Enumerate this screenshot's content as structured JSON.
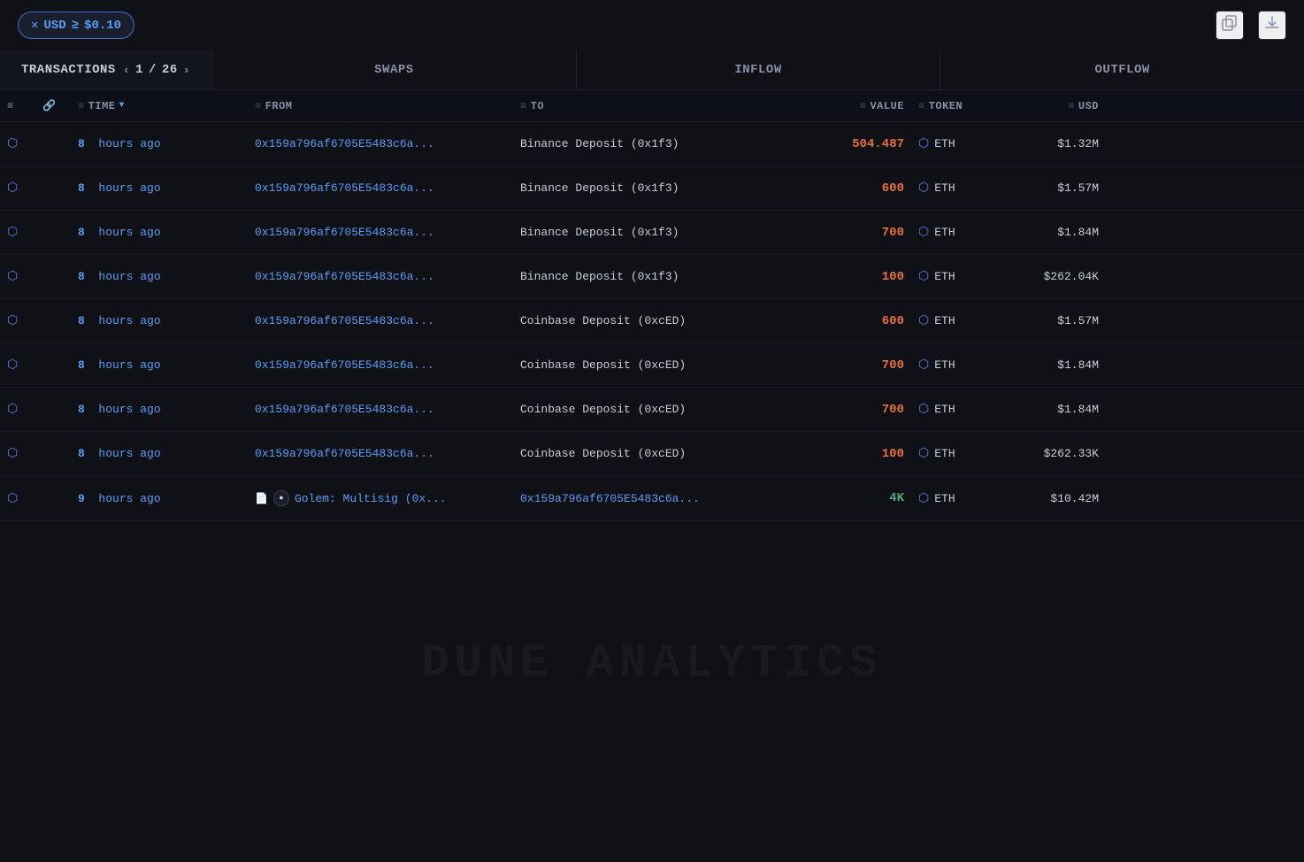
{
  "topbar": {
    "filter_label": "USD",
    "filter_geq": "≥",
    "filter_value": "$0.10",
    "copy_icon": "⧉",
    "download_icon": "↓"
  },
  "nav": {
    "transactions_label": "TRANSACTIONS",
    "page_current": "1",
    "page_separator": "/",
    "page_total": "26",
    "swaps_label": "SWAPS",
    "inflow_label": "INFLOW",
    "outflow_label": "OUTFLOW"
  },
  "columns": {
    "time_label": "TIME",
    "from_label": "FROM",
    "to_label": "TO",
    "value_label": "VALUE",
    "token_label": "TOKEN",
    "usd_label": "USD"
  },
  "rows": [
    {
      "hours": "8",
      "unit": "hours ago",
      "from": "0x159a796af6705E5483c6a...",
      "to": "Binance Deposit (0x1f3)",
      "value": "504.487",
      "value_color": "orange",
      "token": "ETH",
      "usd": "$1.32M",
      "has_doc": false,
      "has_golem": false
    },
    {
      "hours": "8",
      "unit": "hours ago",
      "from": "0x159a796af6705E5483c6a...",
      "to": "Binance Deposit (0x1f3)",
      "value": "600",
      "value_color": "orange",
      "token": "ETH",
      "usd": "$1.57M",
      "has_doc": false,
      "has_golem": false
    },
    {
      "hours": "8",
      "unit": "hours ago",
      "from": "0x159a796af6705E5483c6a...",
      "to": "Binance Deposit (0x1f3)",
      "value": "700",
      "value_color": "orange",
      "token": "ETH",
      "usd": "$1.84M",
      "has_doc": false,
      "has_golem": false
    },
    {
      "hours": "8",
      "unit": "hours ago",
      "from": "0x159a796af6705E5483c6a...",
      "to": "Binance Deposit (0x1f3)",
      "value": "100",
      "value_color": "orange",
      "token": "ETH",
      "usd": "$262.04K",
      "has_doc": false,
      "has_golem": false
    },
    {
      "hours": "8",
      "unit": "hours ago",
      "from": "0x159a796af6705E5483c6a...",
      "to": "Coinbase Deposit (0xcED)",
      "value": "600",
      "value_color": "orange",
      "token": "ETH",
      "usd": "$1.57M",
      "has_doc": false,
      "has_golem": false
    },
    {
      "hours": "8",
      "unit": "hours ago",
      "from": "0x159a796af6705E5483c6a...",
      "to": "Coinbase Deposit (0xcED)",
      "value": "700",
      "value_color": "orange",
      "token": "ETH",
      "usd": "$1.84M",
      "has_doc": false,
      "has_golem": false
    },
    {
      "hours": "8",
      "unit": "hours ago",
      "from": "0x159a796af6705E5483c6a...",
      "to": "Coinbase Deposit (0xcED)",
      "value": "700",
      "value_color": "orange",
      "token": "ETH",
      "usd": "$1.84M",
      "has_doc": false,
      "has_golem": false
    },
    {
      "hours": "8",
      "unit": "hours ago",
      "from": "0x159a796af6705E5483c6a...",
      "to": "Coinbase Deposit (0xcED)",
      "value": "100",
      "value_color": "orange",
      "token": "ETH",
      "usd": "$262.33K",
      "has_doc": false,
      "has_golem": false
    },
    {
      "hours": "9",
      "unit": "hours ago",
      "from": "Golem: Multisig (0x...",
      "to": "0x159a796af6705E5483c6a...",
      "value": "4K",
      "value_color": "green",
      "token": "ETH",
      "usd": "$10.42M",
      "has_doc": true,
      "has_golem": true
    }
  ],
  "watermark": "DUNE ANALYTICS"
}
